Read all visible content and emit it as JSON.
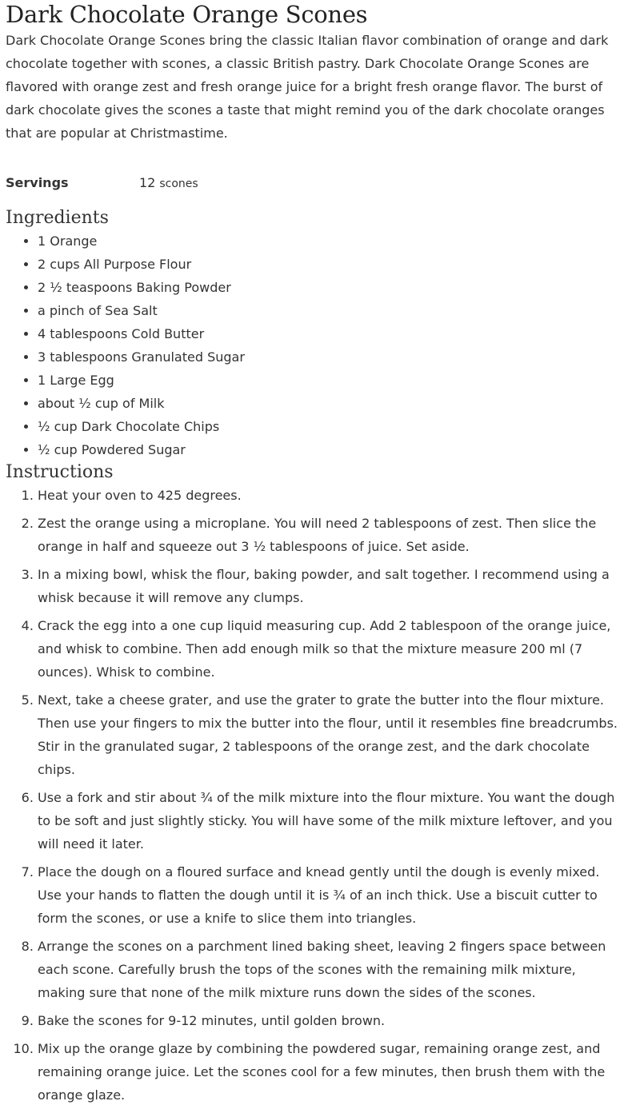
{
  "title": "Dark Chocolate Orange Scones",
  "description": "Dark Chocolate Orange Scones bring the classic Italian flavor combination of orange and dark chocolate together with scones, a classic British pastry. Dark Chocolate Orange Scones are flavored with orange zest and fresh orange juice for a bright fresh orange flavor. The burst of dark chocolate gives the scones a taste that might remind you of the dark chocolate oranges that are popular at Christmastime.",
  "servings": {
    "label": "Servings",
    "amount": "12",
    "unit": "scones"
  },
  "ingredients": {
    "heading": "Ingredients",
    "items": [
      "1 Orange",
      "2 cups All Purpose Flour",
      "2 ½ teaspoons Baking Powder",
      "a pinch of Sea Salt",
      "4 tablespoons Cold Butter",
      "3 tablespoons Granulated Sugar",
      "1 Large Egg",
      "about ½ cup of Milk",
      "½ cup Dark Chocolate Chips",
      "½ cup Powdered Sugar"
    ]
  },
  "instructions": {
    "heading": "Instructions",
    "steps": [
      "Heat your oven to 425 degrees.",
      "Zest the orange using a microplane. You will need 2 tablespoons of zest. Then slice the orange in half and squeeze out 3 ½ tablespoons of juice. Set aside.",
      "In a mixing bowl, whisk the flour, baking powder, and salt together. I recommend using a whisk because it will remove any clumps.",
      "Crack the egg into a one cup liquid measuring cup. Add 2 tablespoon of the orange juice, and whisk to combine. Then add enough milk so that the mixture measure 200 ml (7 ounces). Whisk to combine.",
      "Next, take a cheese grater, and use the grater to grate the butter into the flour mixture. Then use your fingers to mix the butter into the flour, until it resembles fine breadcrumbs. Stir in the granulated sugar, 2 tablespoons of the orange zest, and the dark chocolate chips.",
      "Use a fork and stir about ¾ of the milk mixture into the flour mixture. You want the dough to be soft and just slightly sticky. You will have some of the milk mixture leftover, and you will need it later.",
      "Place the dough on a floured surface and knead gently until the dough is evenly mixed. Use your hands to flatten the dough until it is ¾ of an inch thick. Use a biscuit cutter to form the scones, or use a knife to slice them into triangles.",
      "Arrange the scones on a parchment lined baking sheet, leaving 2 fingers space between each scone. Carefully brush the tops of the scones with the remaining milk mixture, making sure that none of the milk mixture runs down the sides of the scones.",
      "Bake the scones for 9-12 minutes, until golden brown.",
      "Mix up the orange glaze by combining the powdered sugar, remaining orange zest, and remaining orange juice. Let the scones cool for a few minutes, then brush them with the orange glaze."
    ]
  }
}
